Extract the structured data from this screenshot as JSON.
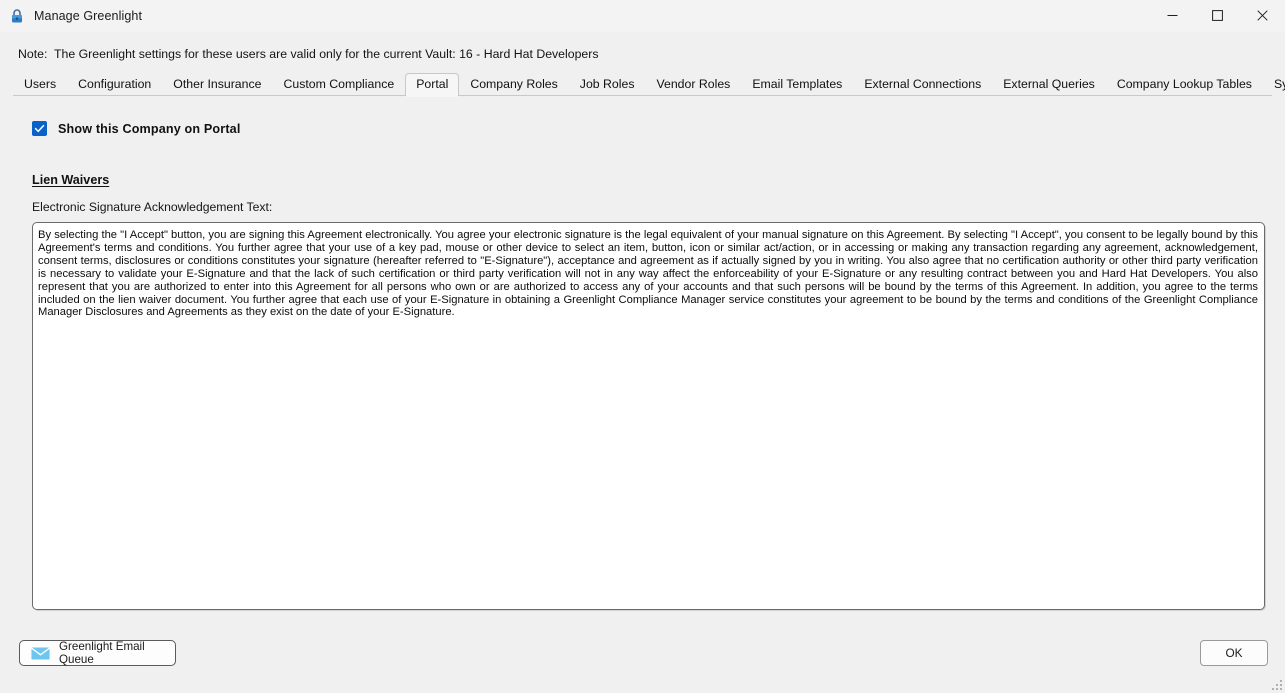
{
  "window": {
    "title": "Manage Greenlight",
    "icon": "lock-icon",
    "accent_color": "#0a62c8",
    "controls": {
      "minimize": "minimize-icon",
      "maximize": "maximize-icon",
      "close": "close-icon"
    }
  },
  "note": {
    "text": "Note:  The Greenlight settings for these users are valid only for the current Vault: 16 - Hard Hat Developers"
  },
  "tabs": {
    "selected": "Portal",
    "items": [
      {
        "label": "Users"
      },
      {
        "label": "Configuration"
      },
      {
        "label": "Other Insurance"
      },
      {
        "label": "Custom Compliance"
      },
      {
        "label": "Portal"
      },
      {
        "label": "Company Roles"
      },
      {
        "label": "Job Roles"
      },
      {
        "label": "Vendor Roles"
      },
      {
        "label": "Email Templates"
      },
      {
        "label": "External Connections"
      },
      {
        "label": "External Queries"
      },
      {
        "label": "Company Lookup Tables"
      },
      {
        "label": "System Lookup Tables"
      }
    ]
  },
  "portal": {
    "show_company_checkbox": {
      "label": "Show this Company on Portal",
      "checked": true
    },
    "section_heading": "Lien Waivers",
    "esig_field_label": "Electronic Signature Acknowledgement Text:",
    "esig_text": "By selecting the \"I Accept\" button, you are signing this Agreement electronically. You agree your electronic signature is the legal equivalent of your manual signature on this Agreement. By selecting \"I Accept\", you consent to be legally bound by this Agreement's terms and conditions. You further agree that your use of a key pad, mouse or other device to select an item, button, icon or similar act/action, or in accessing or making any transaction regarding any agreement, acknowledgement, consent terms, disclosures or conditions constitutes your signature (hereafter referred to \"E-Signature\"), acceptance and agreement as if actually signed by you in writing. You also agree that no certification authority or other third party verification is necessary to validate your E-Signature and that the lack of such certification or third party verification will not in any way affect the enforceability of your E-Signature or any resulting contract between you and Hard Hat Developers. You also represent that you are authorized to enter into this Agreement for all persons who own or are authorized to access any of your accounts and that such persons will be bound by the terms of this Agreement. In addition, you agree to the terms included on the lien waiver document. You further agree that each use of your E-Signature in obtaining a Greenlight Compliance Manager service constitutes your agreement to be bound by the terms and conditions of the Greenlight Compliance Manager Disclosures and Agreements as they exist on the date of your E-Signature."
  },
  "footer": {
    "email_queue_button": {
      "label": "Greenlight Email Queue",
      "icon": "envelope-icon"
    },
    "ok_button": {
      "label": "OK"
    }
  }
}
